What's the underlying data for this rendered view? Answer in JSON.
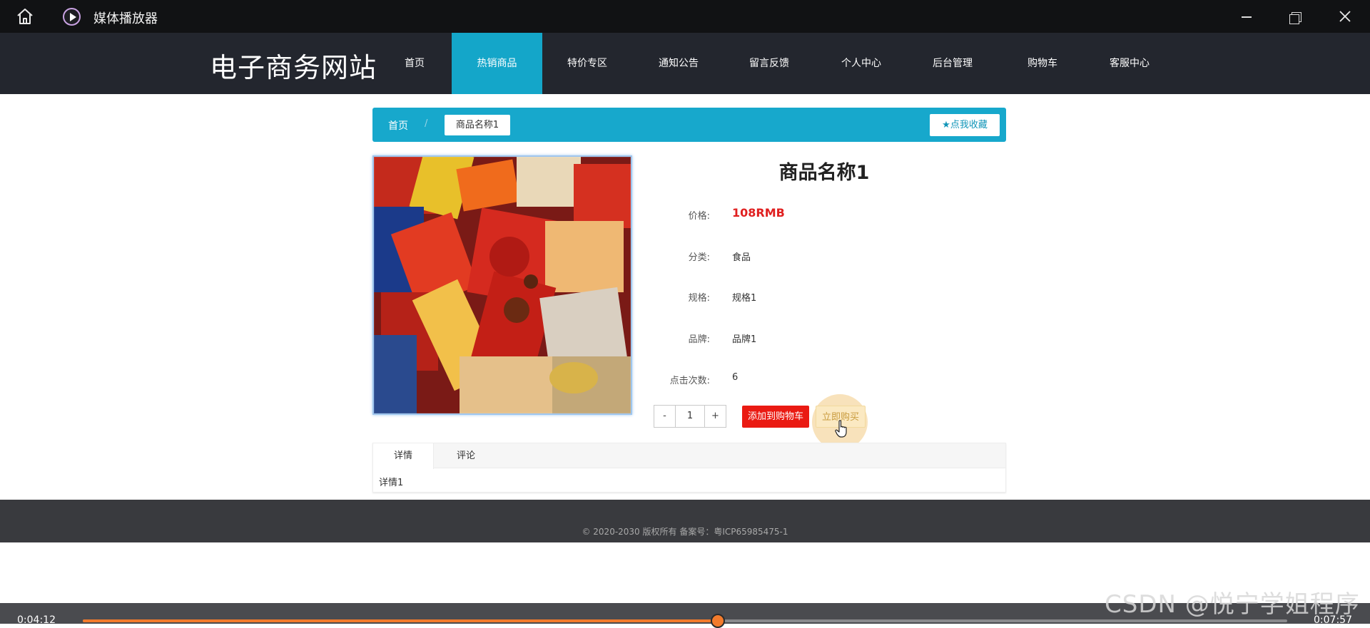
{
  "player_window": {
    "title": "媒体播放器",
    "icons": [
      "home-icon",
      "play-circle-icon",
      "minimize-icon",
      "restore-icon",
      "close-icon"
    ]
  },
  "site": {
    "title": "电子商务网站",
    "nav": [
      {
        "label": "首页",
        "active": false
      },
      {
        "label": "热销商品",
        "active": true
      },
      {
        "label": "特价专区",
        "active": false
      },
      {
        "label": "通知公告",
        "active": false
      },
      {
        "label": "留言反馈",
        "active": false
      },
      {
        "label": "个人中心",
        "active": false
      },
      {
        "label": "后台管理",
        "active": false
      },
      {
        "label": "购物车",
        "active": false
      },
      {
        "label": "客服中心",
        "active": false
      }
    ],
    "accent_color": "#14a6c9"
  },
  "breadcrumb": {
    "home": "首页",
    "separator": "/",
    "current": "商品名称1",
    "favorite_label": "点我收藏"
  },
  "product": {
    "name": "商品名称1",
    "attributes": [
      {
        "key": "price",
        "label": "价格:",
        "value": "108RMB"
      },
      {
        "key": "category",
        "label": "分类:",
        "value": "食品"
      },
      {
        "key": "spec",
        "label": "规格:",
        "value": "规格1"
      },
      {
        "key": "brand",
        "label": "品牌:",
        "value": "品牌1"
      },
      {
        "key": "clicks",
        "label": "点击次数:",
        "value": "6"
      }
    ],
    "quantity": {
      "minus": "-",
      "value": "1",
      "plus": "+"
    },
    "add_to_cart_label": "添加到购物车",
    "buy_now_label": "立即购买"
  },
  "tabs": {
    "items": [
      {
        "label": "详情",
        "active": true
      },
      {
        "label": "评论",
        "active": false
      }
    ],
    "content": "详情1"
  },
  "footer": {
    "copyright": "© 2020-2030 版权所有 备案号：粤ICP65985475-1"
  },
  "player": {
    "current_time": "0:04:12",
    "total_time": "0:07:57",
    "progress": 0.5275
  },
  "watermark": "CSDN @悦宁学姐程序"
}
